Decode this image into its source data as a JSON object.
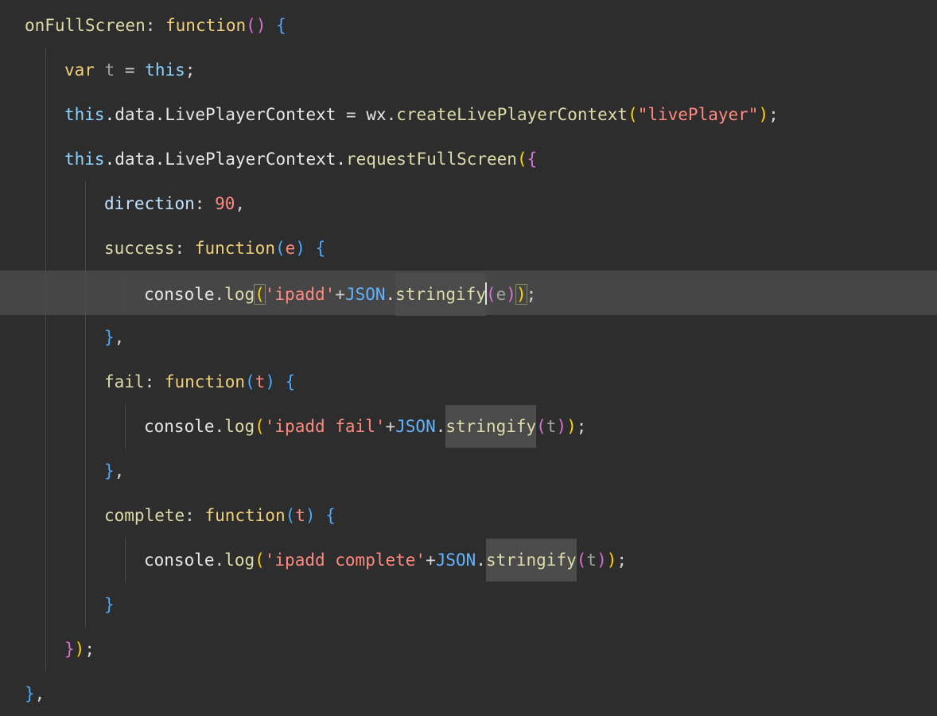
{
  "editor": {
    "lines": [
      {
        "indent": 0,
        "tokens": [
          {
            "t": "onFullScreen",
            "c": "tok-fn"
          },
          {
            "t": ": ",
            "c": "tok-punc"
          },
          {
            "t": "function",
            "c": "tok-kw"
          },
          {
            "t": "()",
            "c": "tok-b2"
          },
          {
            "t": " ",
            "c": "tok-punc"
          },
          {
            "t": "{",
            "c": "tok-b3"
          }
        ]
      },
      {
        "indent": 1,
        "tokens": [
          {
            "t": "var",
            "c": "tok-kw"
          },
          {
            "t": " t ",
            "c": "tok-var"
          },
          {
            "t": "= ",
            "c": "tok-op"
          },
          {
            "t": "this",
            "c": "tok-this"
          },
          {
            "t": ";",
            "c": "tok-punc"
          }
        ]
      },
      {
        "indent": 1,
        "tokens": [
          {
            "t": "this",
            "c": "tok-this"
          },
          {
            "t": ".data.LivePlayerContext ",
            "c": "tok-prop"
          },
          {
            "t": "= ",
            "c": "tok-op"
          },
          {
            "t": "wx",
            "c": "tok-prop"
          },
          {
            "t": ".",
            "c": "tok-punc"
          },
          {
            "t": "createLivePlayerContext",
            "c": "tok-fn"
          },
          {
            "t": "(",
            "c": "tok-b1"
          },
          {
            "t": "\"livePlayer\"",
            "c": "tok-str"
          },
          {
            "t": ")",
            "c": "tok-b1"
          },
          {
            "t": ";",
            "c": "tok-punc"
          }
        ]
      },
      {
        "indent": 1,
        "tokens": [
          {
            "t": "this",
            "c": "tok-this"
          },
          {
            "t": ".data.LivePlayerContext.",
            "c": "tok-prop"
          },
          {
            "t": "requestFullScreen",
            "c": "tok-fn"
          },
          {
            "t": "(",
            "c": "tok-b1"
          },
          {
            "t": "{",
            "c": "tok-b2"
          }
        ]
      },
      {
        "indent": 2,
        "tokens": [
          {
            "t": "direction",
            "c": "tok-key"
          },
          {
            "t": ": ",
            "c": "tok-punc"
          },
          {
            "t": "90",
            "c": "tok-num"
          },
          {
            "t": ",",
            "c": "tok-punc"
          }
        ]
      },
      {
        "indent": 2,
        "tokens": [
          {
            "t": "success",
            "c": "tok-fn"
          },
          {
            "t": ": ",
            "c": "tok-punc"
          },
          {
            "t": "function",
            "c": "tok-kw"
          },
          {
            "t": "(",
            "c": "tok-b3"
          },
          {
            "t": "e",
            "c": "tok-param"
          },
          {
            "t": ")",
            "c": "tok-b3"
          },
          {
            "t": " ",
            "c": "tok-punc"
          },
          {
            "t": "{",
            "c": "tok-b3"
          }
        ]
      },
      {
        "indent": 3,
        "current": true,
        "tokens": [
          {
            "t": "console",
            "c": "tok-prop"
          },
          {
            "t": ".",
            "c": "tok-punc"
          },
          {
            "t": "log",
            "c": "tok-fn"
          },
          {
            "t": "(",
            "c": "tok-b1",
            "m": "match"
          },
          {
            "t": "'ipadd'",
            "c": "tok-str"
          },
          {
            "t": "+",
            "c": "tok-op"
          },
          {
            "t": "JSON",
            "c": "tok-obj"
          },
          {
            "t": ".",
            "c": "tok-punc"
          },
          {
            "t": "stringify",
            "c": "tok-fn",
            "m": "hl"
          },
          {
            "t": "",
            "caret": true
          },
          {
            "t": "(",
            "c": "tok-b2"
          },
          {
            "t": "e",
            "c": "tok-var"
          },
          {
            "t": ")",
            "c": "tok-b2"
          },
          {
            "t": ")",
            "c": "tok-b1",
            "m": "match"
          },
          {
            "t": ";",
            "c": "tok-punc"
          }
        ]
      },
      {
        "indent": 2,
        "tokens": [
          {
            "t": "}",
            "c": "tok-b3"
          },
          {
            "t": ",",
            "c": "tok-punc"
          }
        ]
      },
      {
        "indent": 2,
        "tokens": [
          {
            "t": "fail",
            "c": "tok-fn"
          },
          {
            "t": ": ",
            "c": "tok-punc"
          },
          {
            "t": "function",
            "c": "tok-kw"
          },
          {
            "t": "(",
            "c": "tok-b3"
          },
          {
            "t": "t",
            "c": "tok-param"
          },
          {
            "t": ")",
            "c": "tok-b3"
          },
          {
            "t": " ",
            "c": "tok-punc"
          },
          {
            "t": "{",
            "c": "tok-b3"
          }
        ]
      },
      {
        "indent": 3,
        "tokens": [
          {
            "t": "console",
            "c": "tok-prop"
          },
          {
            "t": ".",
            "c": "tok-punc"
          },
          {
            "t": "log",
            "c": "tok-fn"
          },
          {
            "t": "(",
            "c": "tok-b1"
          },
          {
            "t": "'ipadd fail'",
            "c": "tok-str"
          },
          {
            "t": "+",
            "c": "tok-op"
          },
          {
            "t": "JSON",
            "c": "tok-obj"
          },
          {
            "t": ".",
            "c": "tok-punc"
          },
          {
            "t": "stringify",
            "c": "tok-fn",
            "m": "hl"
          },
          {
            "t": "(",
            "c": "tok-b2"
          },
          {
            "t": "t",
            "c": "tok-var"
          },
          {
            "t": ")",
            "c": "tok-b2"
          },
          {
            "t": ")",
            "c": "tok-b1"
          },
          {
            "t": ";",
            "c": "tok-punc"
          }
        ]
      },
      {
        "indent": 2,
        "tokens": [
          {
            "t": "}",
            "c": "tok-b3"
          },
          {
            "t": ",",
            "c": "tok-punc"
          }
        ]
      },
      {
        "indent": 2,
        "tokens": [
          {
            "t": "complete",
            "c": "tok-fn"
          },
          {
            "t": ": ",
            "c": "tok-punc"
          },
          {
            "t": "function",
            "c": "tok-kw"
          },
          {
            "t": "(",
            "c": "tok-b3"
          },
          {
            "t": "t",
            "c": "tok-param"
          },
          {
            "t": ")",
            "c": "tok-b3"
          },
          {
            "t": " ",
            "c": "tok-punc"
          },
          {
            "t": "{",
            "c": "tok-b3"
          }
        ]
      },
      {
        "indent": 3,
        "tokens": [
          {
            "t": "console",
            "c": "tok-prop"
          },
          {
            "t": ".",
            "c": "tok-punc"
          },
          {
            "t": "log",
            "c": "tok-fn"
          },
          {
            "t": "(",
            "c": "tok-b1"
          },
          {
            "t": "'ipadd complete'",
            "c": "tok-str"
          },
          {
            "t": "+",
            "c": "tok-op"
          },
          {
            "t": "JSON",
            "c": "tok-obj"
          },
          {
            "t": ".",
            "c": "tok-punc"
          },
          {
            "t": "stringify",
            "c": "tok-fn",
            "m": "hl"
          },
          {
            "t": "(",
            "c": "tok-b2"
          },
          {
            "t": "t",
            "c": "tok-var"
          },
          {
            "t": ")",
            "c": "tok-b2"
          },
          {
            "t": ")",
            "c": "tok-b1"
          },
          {
            "t": ";",
            "c": "tok-punc"
          }
        ]
      },
      {
        "indent": 2,
        "tokens": [
          {
            "t": "}",
            "c": "tok-b3"
          }
        ]
      },
      {
        "indent": 1,
        "tokens": [
          {
            "t": "}",
            "c": "tok-b2"
          },
          {
            "t": ")",
            "c": "tok-b1"
          },
          {
            "t": ";",
            "c": "tok-punc"
          }
        ]
      },
      {
        "indent": 0,
        "tokens": [
          {
            "t": "}",
            "c": "tok-b3"
          },
          {
            "t": ",",
            "c": "tok-punc"
          }
        ]
      }
    ]
  }
}
